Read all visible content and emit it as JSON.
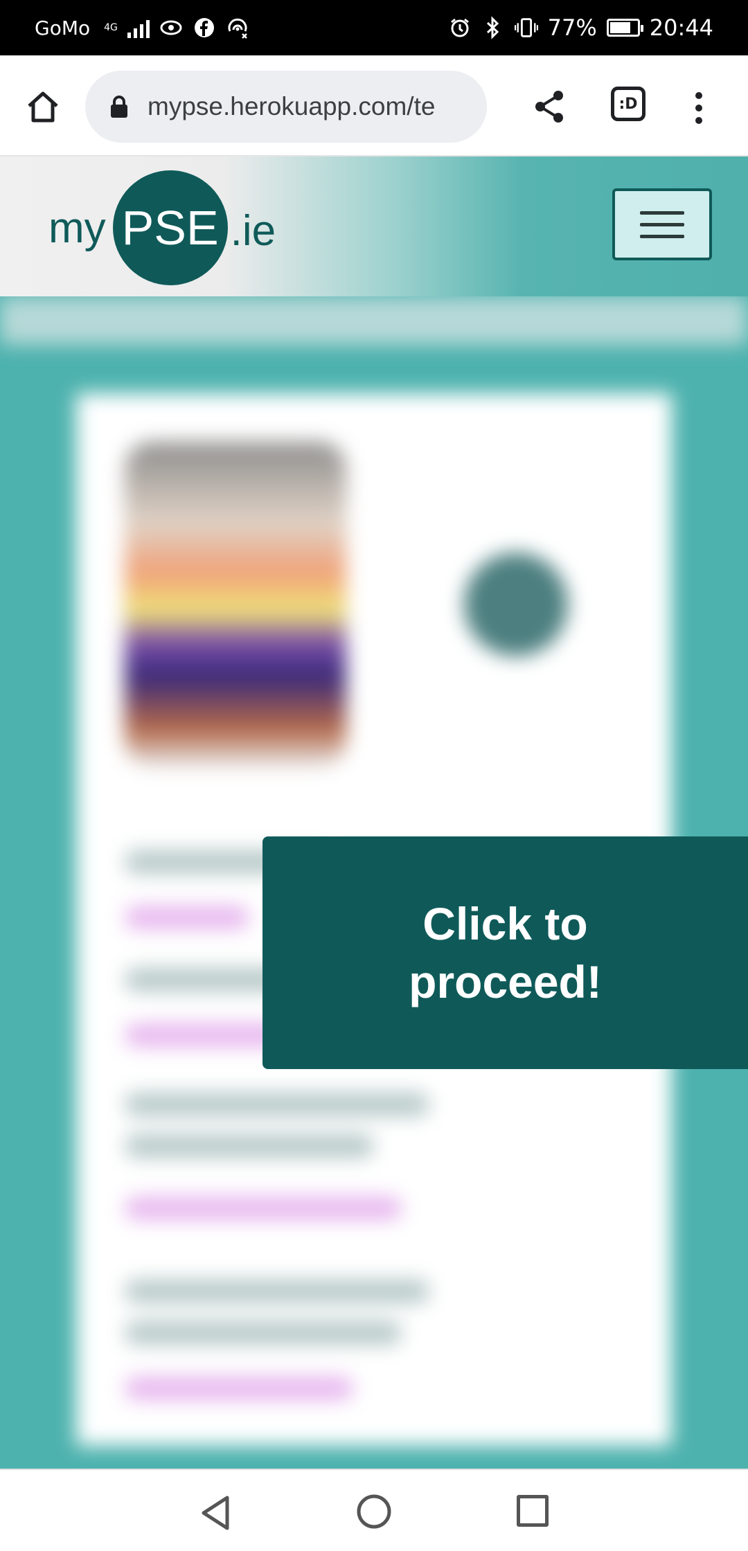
{
  "status_bar": {
    "carrier": "GoMo",
    "network_type": "4G",
    "battery_percent": "77%",
    "battery_level": 0.77,
    "time": "20:44",
    "icons": [
      "signal-icon",
      "eye-icon",
      "facebook-icon",
      "hotspot-icon",
      "alarm-icon",
      "bluetooth-icon",
      "vibrate-icon",
      "battery-icon"
    ]
  },
  "browser": {
    "url": "mypse.herokuapp.com/te",
    "tab_button_label": ":D",
    "icons": [
      "home-icon",
      "lock-icon",
      "share-icon",
      "tab-switcher-icon",
      "more-vert-icon"
    ]
  },
  "site_header": {
    "logo_prefix": "my",
    "logo_main": "PSE",
    "logo_suffix": ".ie",
    "brand_color": "#0f5a59",
    "accent_color": "#4db2ae"
  },
  "overlay": {
    "proceed_line1": "Click to",
    "proceed_line2": "proceed!"
  },
  "nav_bar": {
    "icons": [
      "back-icon",
      "home-circle-icon",
      "recent-apps-icon"
    ]
  }
}
